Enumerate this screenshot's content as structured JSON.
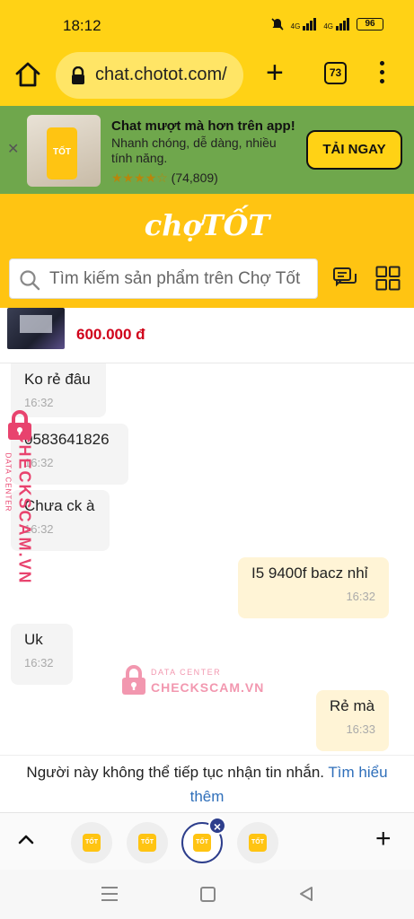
{
  "status_bar": {
    "time": "18:12",
    "battery": "96",
    "net1": "4G",
    "net2": "4G"
  },
  "browser": {
    "url": "chat.chotot.com/",
    "tab_count": "73"
  },
  "app_banner": {
    "title": "Chat mượt mà hơn trên app!",
    "subtitle": "Nhanh chóng, dễ dàng, nhiều tính năng.",
    "stars": "★★★★☆",
    "rating_count": "(74,809)",
    "cta": "TẢI NGAY",
    "phone_label": "TỐT"
  },
  "header": {
    "logo": "chợTỐT",
    "search_placeholder": "Tìm kiếm sản phẩm trên Chợ Tốt"
  },
  "product": {
    "price": "600.000 đ"
  },
  "messages": [
    {
      "side": "in",
      "text": "Ko rẻ đâu",
      "time": "16:32"
    },
    {
      "side": "in",
      "text": "0583641826",
      "time": "16:32"
    },
    {
      "side": "in",
      "text": "Chưa ck à",
      "time": "16:32"
    },
    {
      "side": "out",
      "text": "I5 9400f bacz nhỉ",
      "time": "16:32"
    },
    {
      "side": "in",
      "text": "Uk",
      "time": "16:32"
    },
    {
      "side": "out",
      "text": "Rẻ mà",
      "time": "16:33"
    }
  ],
  "watermark": {
    "side_text": "CHECKSCAM.VN",
    "small_text": "DATA CENTER",
    "center_top": "DATA CENTER",
    "center_main": "CHECKSCAM.VN"
  },
  "notice": {
    "text": "Người này không thể tiếp tục nhận tin nhắn. ",
    "link": "Tìm hiểu thêm"
  },
  "tab_strip": {
    "fav_label": "TỐT",
    "close": "×",
    "add": "+"
  },
  "colors": {
    "brand_yellow": "#FFC412",
    "chrome_yellow": "#FFD215",
    "banner_green": "#6FA74C",
    "price_red": "#D0021B",
    "watermark_pink": "#E8436E",
    "link_blue": "#2F6FBA"
  }
}
